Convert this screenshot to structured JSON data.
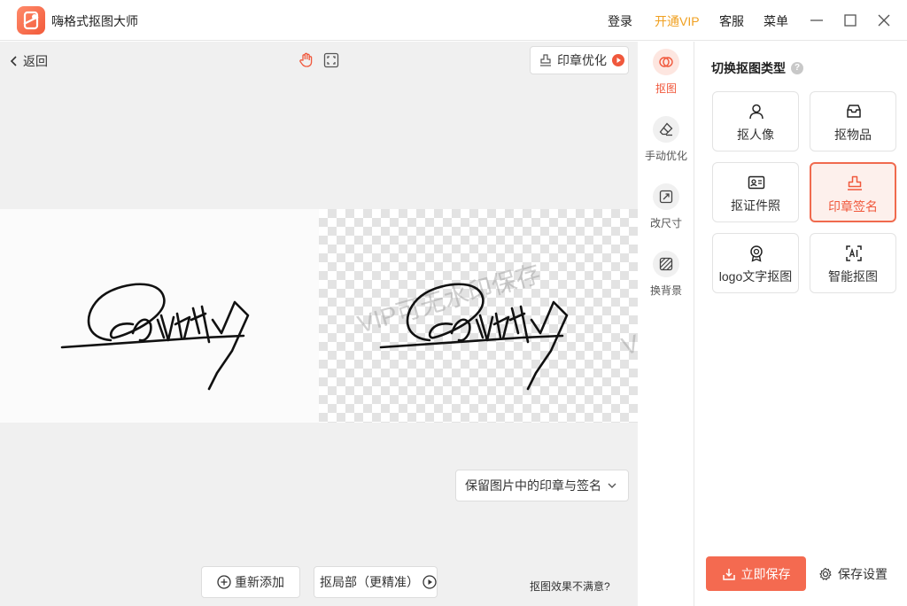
{
  "app": {
    "title": "嗨格式抠图大师"
  },
  "titlebar": {
    "login": "登录",
    "vip": "开通VIP",
    "service": "客服",
    "menu": "菜单"
  },
  "canvas": {
    "back": "返回",
    "stamp_optimize": "印章优化",
    "watermark": "VIP可无水印保存",
    "keep_option": "保留图片中的印章与签名",
    "readd": "重新添加",
    "local_cutout": "抠局部（更精准）",
    "unsatisfied": "抠图效果不满意?"
  },
  "tools": [
    {
      "label": "抠图",
      "icon": "cutout-icon",
      "active": true
    },
    {
      "label": "手动优化",
      "icon": "eraser-icon",
      "active": false
    },
    {
      "label": "改尺寸",
      "icon": "resize-icon",
      "active": false
    },
    {
      "label": "换背景",
      "icon": "background-icon",
      "active": false
    }
  ],
  "panel": {
    "title": "切换抠图类型",
    "types": [
      {
        "label": "抠人像",
        "icon": "person-icon"
      },
      {
        "label": "抠物品",
        "icon": "inbox-icon"
      },
      {
        "label": "抠证件照",
        "icon": "id-card-icon"
      },
      {
        "label": "印章签名",
        "icon": "stamp-icon",
        "active": true
      },
      {
        "label": "logo文字抠图",
        "icon": "badge-icon"
      },
      {
        "label": "智能抠图",
        "icon": "ai-icon"
      }
    ],
    "save_now": "立即保存",
    "save_settings": "保存设置"
  },
  "colors": {
    "accent": "#f46a50",
    "vip": "#f0a020",
    "active_bg": "#fdf0ec"
  }
}
